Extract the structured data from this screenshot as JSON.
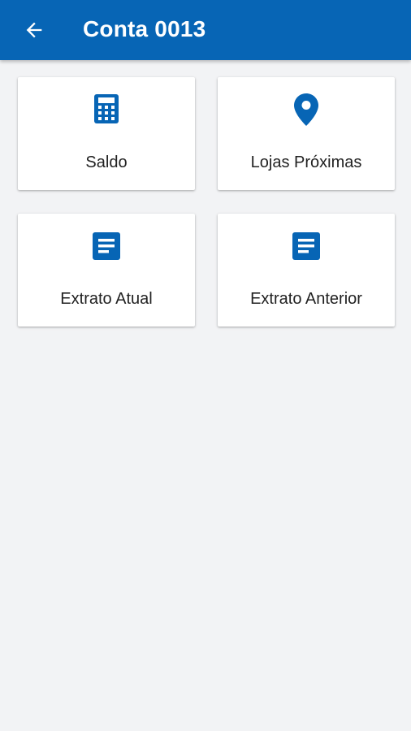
{
  "app_bar": {
    "title": "Conta 0013",
    "back_icon": "arrow-back-icon",
    "background_color": "#0765b5",
    "text_color": "#ffffff"
  },
  "menu": {
    "accent_color": "#0765b5",
    "items": [
      {
        "label": "Saldo",
        "icon": "calculator-icon"
      },
      {
        "label": "Lojas Próximas",
        "icon": "location-pin-icon"
      },
      {
        "label": "Extrato Atual",
        "icon": "document-icon"
      },
      {
        "label": "Extrato Anterior",
        "icon": "document-icon"
      }
    ]
  }
}
